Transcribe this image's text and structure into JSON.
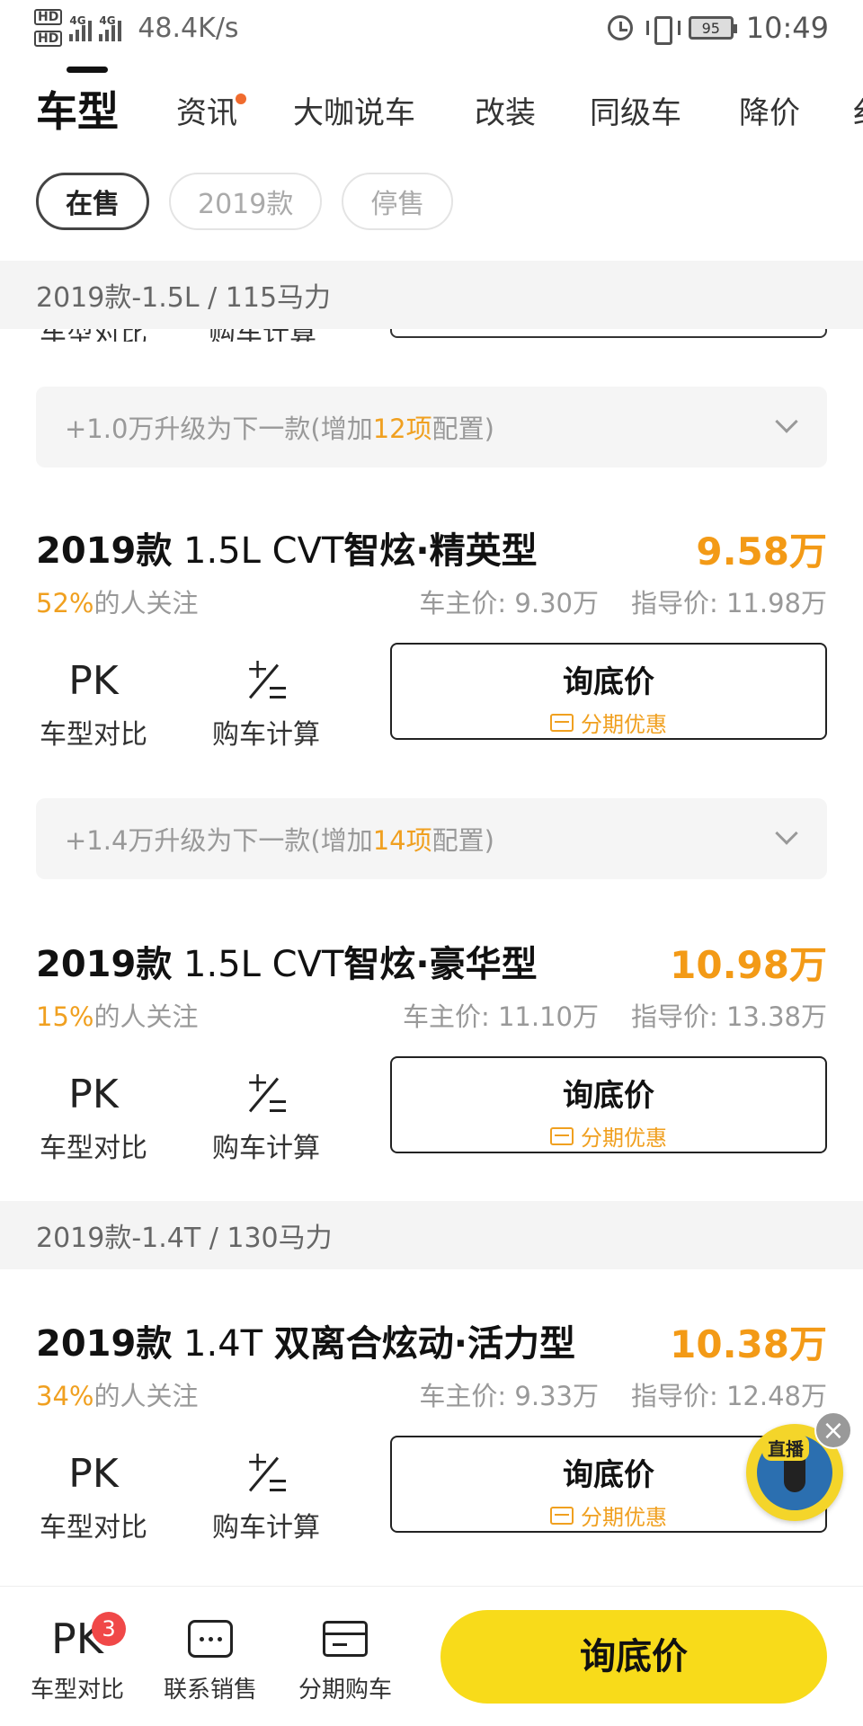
{
  "status_bar": {
    "hd1": "HD",
    "hd2": "HD",
    "net1": "4G",
    "net2": "4G",
    "speed": "48.4K/s",
    "battery": "95",
    "time": "10:49"
  },
  "tabs": [
    {
      "label": "车型",
      "active": true
    },
    {
      "label": "资讯",
      "dot": true
    },
    {
      "label": "大咖说车"
    },
    {
      "label": "改装"
    },
    {
      "label": "同级车"
    },
    {
      "label": "降价"
    },
    {
      "label": "纟"
    }
  ],
  "filters": [
    {
      "label": "在售",
      "active": true
    },
    {
      "label": "2019款"
    },
    {
      "label": "停售"
    }
  ],
  "sections": [
    {
      "title": "2019款-1.5L / 115马力"
    },
    {
      "title": "2019款-1.4T / 130马力"
    }
  ],
  "clipped_row": {
    "compare": "车型对比",
    "calc": "购车计算"
  },
  "upgrades": [
    {
      "prefix": "+1.0万升级为下一款(增加",
      "count": "12项",
      "suffix": "配置)"
    },
    {
      "prefix": "+1.4万升级为下一款(增加",
      "count": "14项",
      "suffix": "配置)"
    }
  ],
  "cars": [
    {
      "year": "2019款",
      "spec": "1.5L CVT",
      "trim": "智炫·精英型",
      "price": "9.58万",
      "attention_pct": "52%",
      "attention_text": "的人关注",
      "owner_price": "车主价: 9.30万",
      "guide_price": "指导价: 11.98万"
    },
    {
      "year": "2019款",
      "spec": "1.5L CVT",
      "trim": "智炫·豪华型",
      "price": "10.98万",
      "attention_pct": "15%",
      "attention_text": "的人关注",
      "owner_price": "车主价: 11.10万",
      "guide_price": "指导价: 13.38万"
    },
    {
      "year": "2019款",
      "spec": "1.4T",
      "trim": "双离合炫动·活力型",
      "price": "10.38万",
      "attention_pct": "34%",
      "attention_text": "的人关注",
      "owner_price": "车主价: 9.33万",
      "guide_price": "指导价: 12.48万"
    }
  ],
  "actions": {
    "pk_icon": "PK",
    "compare_label": "车型对比",
    "calc_label": "购车计算",
    "inquire_label": "询底价",
    "installment_label": "分期优惠"
  },
  "live": {
    "tag": "直播",
    "close": "×"
  },
  "bottom_bar": {
    "compare_icon": "PK",
    "compare_badge": "3",
    "compare_label": "车型对比",
    "contact_label": "联系销售",
    "installment_label": "分期购车",
    "cta_label": "询底价"
  },
  "colors": {
    "accent_orange": "#f39a16",
    "cta_yellow": "#f8db1a",
    "badge_red": "#f04848"
  }
}
